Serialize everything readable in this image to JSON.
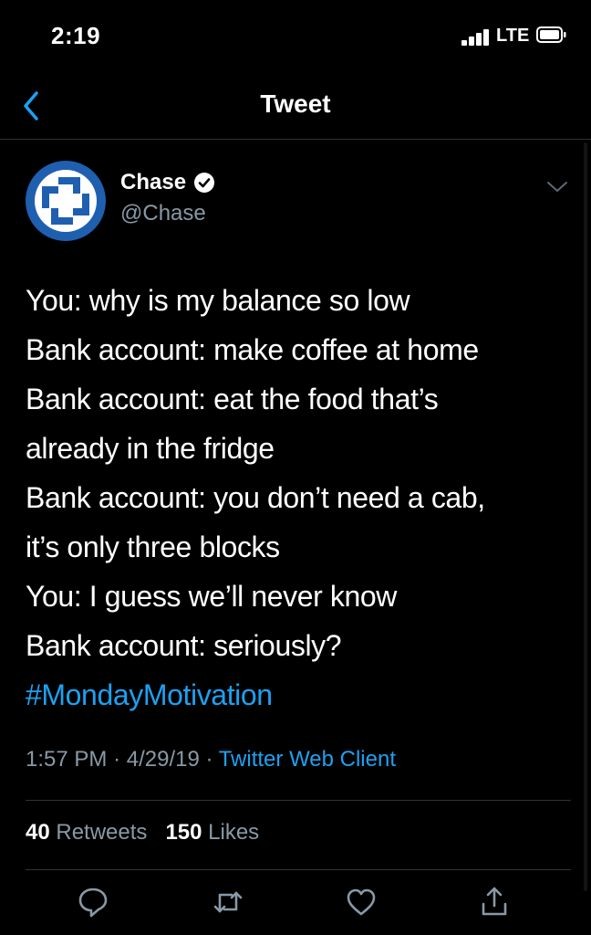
{
  "status_bar": {
    "time": "2:19",
    "network": "LTE"
  },
  "navbar": {
    "title": "Tweet"
  },
  "tweet": {
    "author_name": "Chase",
    "author_handle": "@Chase",
    "lines": [
      "You: why is my balance so low",
      "Bank account: make coffee at home",
      "Bank account: eat the food that’s",
      "already in the fridge",
      "Bank account: you don’t need a cab,",
      "it’s only three blocks",
      "You: I guess we’ll never know",
      "Bank account: seriously?"
    ],
    "hashtag": "#MondayMotivation",
    "time": "1:57 PM",
    "date": "4/29/19",
    "separator": "·",
    "client": "Twitter Web Client",
    "retweet_count": "40",
    "retweet_label": "Retweets",
    "like_count": "150",
    "like_label": "Likes"
  },
  "colors": {
    "background": "#000000",
    "accent": "#1da1f2",
    "muted": "#8899a6",
    "chase_blue": "#1f5fb0"
  },
  "icons": [
    "back-chevron-icon",
    "verified-badge-icon",
    "chevron-down-icon",
    "reply-icon",
    "retweet-icon",
    "like-icon",
    "share-icon"
  ]
}
